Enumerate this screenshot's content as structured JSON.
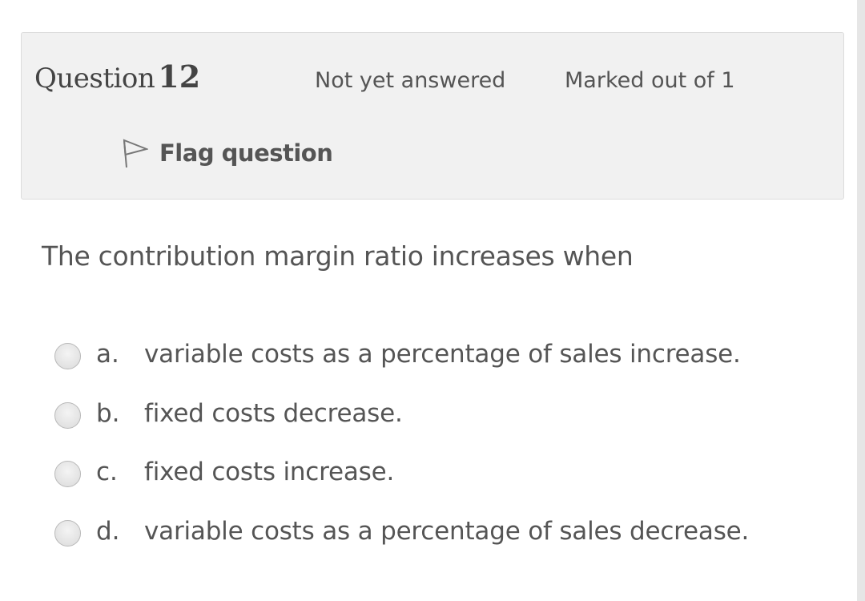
{
  "question": {
    "word": "Question",
    "number": "12",
    "state": "Not yet answered",
    "grade": "Marked out of 1",
    "flag_label": "Flag question",
    "flag_icon": "flag-outline-icon",
    "text": "The contribution margin ratio increases when"
  },
  "answers": [
    {
      "letter": "a.",
      "text": "variable costs as a percentage of sales increase.",
      "selected": false
    },
    {
      "letter": "b.",
      "text": "fixed costs decrease.",
      "selected": false
    },
    {
      "letter": "c.",
      "text": "fixed costs increase.",
      "selected": false
    },
    {
      "letter": "d.",
      "text": "variable costs as a percentage of sales decrease.",
      "selected": false
    }
  ],
  "colors": {
    "info_background": "#f1f1f1",
    "info_border": "#dcdcdc",
    "text": "#555555"
  }
}
